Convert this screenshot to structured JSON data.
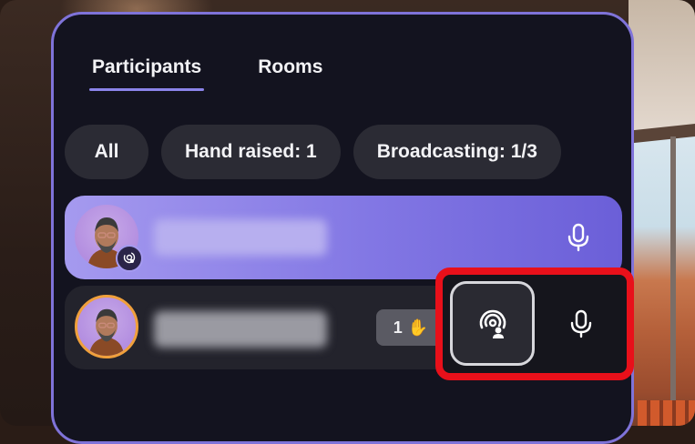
{
  "tabs": [
    {
      "label": "Participants",
      "active": true
    },
    {
      "label": "Rooms",
      "active": false
    }
  ],
  "filters": [
    {
      "label": "All"
    },
    {
      "label": "Hand raised: 1"
    },
    {
      "label": "Broadcasting: 1/3"
    }
  ],
  "participants": [
    {
      "name_hidden": true,
      "broadcasting_badge": true,
      "mic": "mic-icon"
    },
    {
      "name_hidden": true,
      "hand_raised": {
        "count": "1",
        "emoji": "✋"
      },
      "mic": "mic-icon",
      "broadcast_control": "broadcast-icon"
    }
  ],
  "colors": {
    "accent": "#8b84ea",
    "panel": "#13131f",
    "highlight": "#e8101a",
    "row_active": "#8277e4"
  }
}
